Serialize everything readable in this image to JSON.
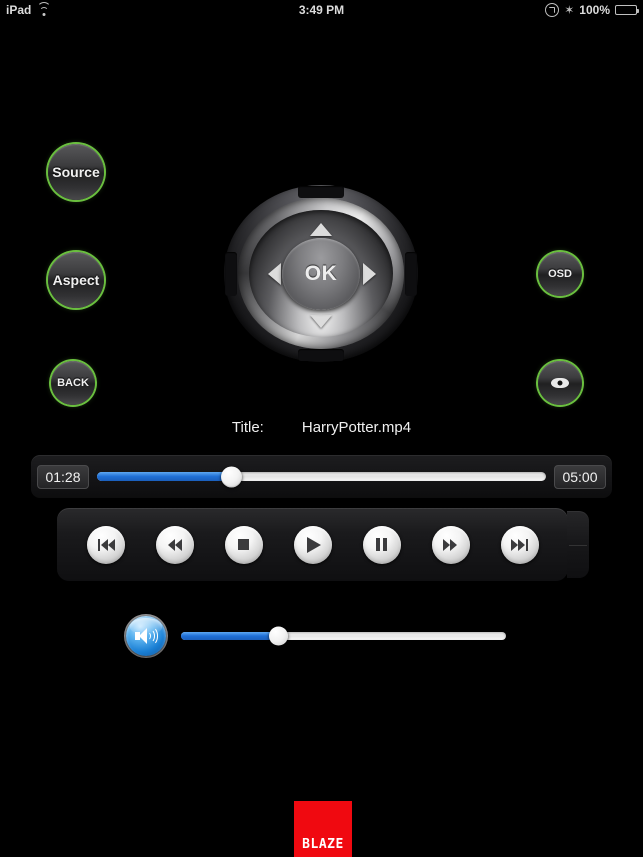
{
  "statusbar": {
    "device": "iPad",
    "wifi_icon": "wifi-icon",
    "time": "3:49 PM",
    "rotation_lock_icon": "rotation-lock-icon",
    "bluetooth_icon": "bluetooth-icon",
    "battery_percent": "100%",
    "battery_icon": "battery-icon"
  },
  "controls": {
    "source_label": "Source",
    "aspect_label": "Aspect",
    "back_label": "BACK",
    "osd_label": "OSD",
    "eye_icon": "eye-icon",
    "ring_color": "#6abf3f"
  },
  "dpad": {
    "ok_label": "OK",
    "up_icon": "arrow-up-icon",
    "down_icon": "arrow-down-icon",
    "left_icon": "arrow-left-icon",
    "right_icon": "arrow-right-icon"
  },
  "media": {
    "title_label": "Title:",
    "title_value": "HarryPotter.mp4",
    "elapsed": "01:28",
    "duration": "05:00",
    "progress_percent": 30,
    "accent_color": "#1f6fd6"
  },
  "transport": {
    "buttons": [
      {
        "name": "previous-track-button",
        "icon": "skip-back-icon"
      },
      {
        "name": "rewind-button",
        "icon": "rewind-icon"
      },
      {
        "name": "stop-button",
        "icon": "stop-icon"
      },
      {
        "name": "play-button",
        "icon": "play-icon"
      },
      {
        "name": "pause-button",
        "icon": "pause-icon"
      },
      {
        "name": "fast-forward-button",
        "icon": "fast-forward-icon"
      },
      {
        "name": "next-track-button",
        "icon": "skip-forward-icon"
      }
    ]
  },
  "volume": {
    "speaker_icon": "speaker-icon",
    "level_percent": 30
  },
  "branding": {
    "logo_text": "BLAZE",
    "logo_color": "#f00910"
  }
}
